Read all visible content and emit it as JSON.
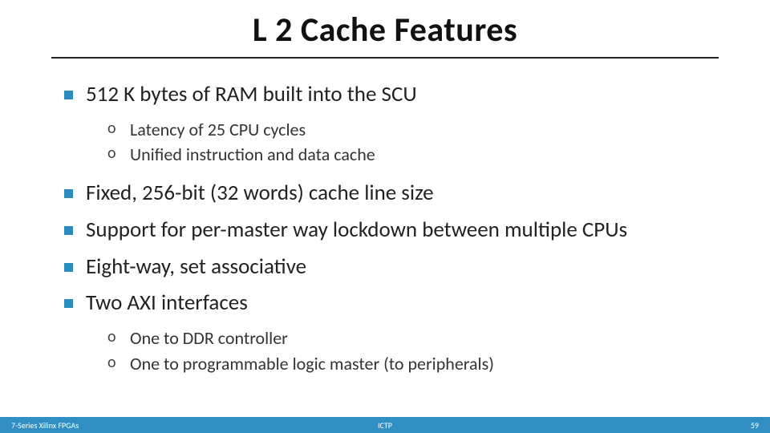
{
  "title": "L 2 Cache Features",
  "bullets": {
    "b0": {
      "text": "512 K bytes of RAM built into the SCU",
      "subs": {
        "s0": "Latency of 25 CPU cycles",
        "s1": "Unified instruction and data cache"
      }
    },
    "b1": {
      "text": "Fixed, 256-bit (32 words) cache line size"
    },
    "b2": {
      "text": "Support for per-master way lockdown between multiple CPUs"
    },
    "b3": {
      "text": "Eight-way, set associative"
    },
    "b4": {
      "text": "Two AXI interfaces",
      "subs": {
        "s0": "One to DDR controller",
        "s1": "One to programmable logic master (to peripherals)"
      }
    }
  },
  "footer": {
    "left": "7-Series Xilinx FPGAs",
    "center": "ICTP",
    "right": "59"
  }
}
